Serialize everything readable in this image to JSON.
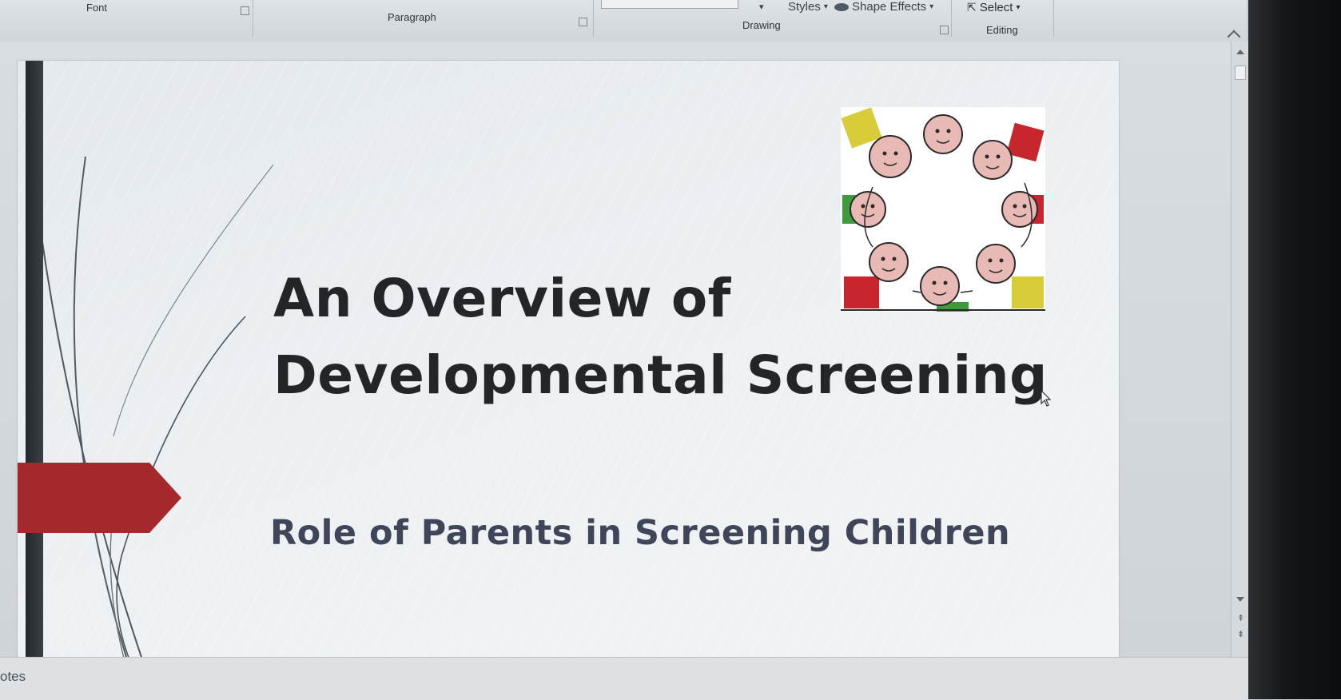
{
  "ribbon": {
    "groups": {
      "font": "Font",
      "paragraph": "Paragraph",
      "drawing": "Drawing",
      "editing": "Editing"
    },
    "controls": {
      "quick_styles": "Styles",
      "shape_effects": "Shape Effects",
      "select": "Select"
    }
  },
  "slide": {
    "title_line1": "An Overview of",
    "title_line2": "Developmental Screening",
    "subtitle": "Role of Parents in Screening Children",
    "accent_color": "#a4282c",
    "bar_color": "#2b2f33",
    "title_color": "#222629",
    "subtitle_color": "#40465a"
  },
  "clipart": {
    "icon": "children-circle-clipart"
  },
  "notes": {
    "label": "otes"
  }
}
